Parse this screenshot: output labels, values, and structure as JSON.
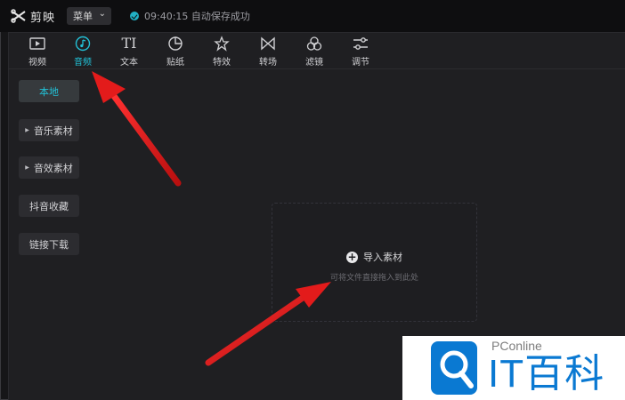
{
  "app": {
    "name": "剪映",
    "menu_label": "菜单",
    "save_status": "09:40:15 自动保存成功"
  },
  "toolbar": {
    "tabs": [
      {
        "label": "视频",
        "icon": "video-icon"
      },
      {
        "label": "音频",
        "icon": "audio-icon",
        "active": true
      },
      {
        "label": "文本",
        "icon": "text-icon",
        "glyph": "TI"
      },
      {
        "label": "贴纸",
        "icon": "sticker-icon"
      },
      {
        "label": "特效",
        "icon": "effects-icon"
      },
      {
        "label": "转场",
        "icon": "transition-icon"
      },
      {
        "label": "滤镜",
        "icon": "filter-icon"
      },
      {
        "label": "调节",
        "icon": "adjust-icon"
      }
    ]
  },
  "sidebar": {
    "items": [
      {
        "label": "本地",
        "active": true
      },
      {
        "label": "音乐素材",
        "expandable": true
      },
      {
        "label": "音效素材",
        "expandable": true
      },
      {
        "label": "抖音收藏"
      },
      {
        "label": "链接下载"
      }
    ]
  },
  "dropzone": {
    "import_label": "导入素材",
    "hint": "可将文件直接拖入到此处"
  },
  "watermark": {
    "small_text": "PConline",
    "big_text": "IT百科"
  },
  "colors": {
    "accent": "#22c0d6",
    "arrow": "#e31b1b",
    "watermark_blue": "#0a79d2"
  }
}
